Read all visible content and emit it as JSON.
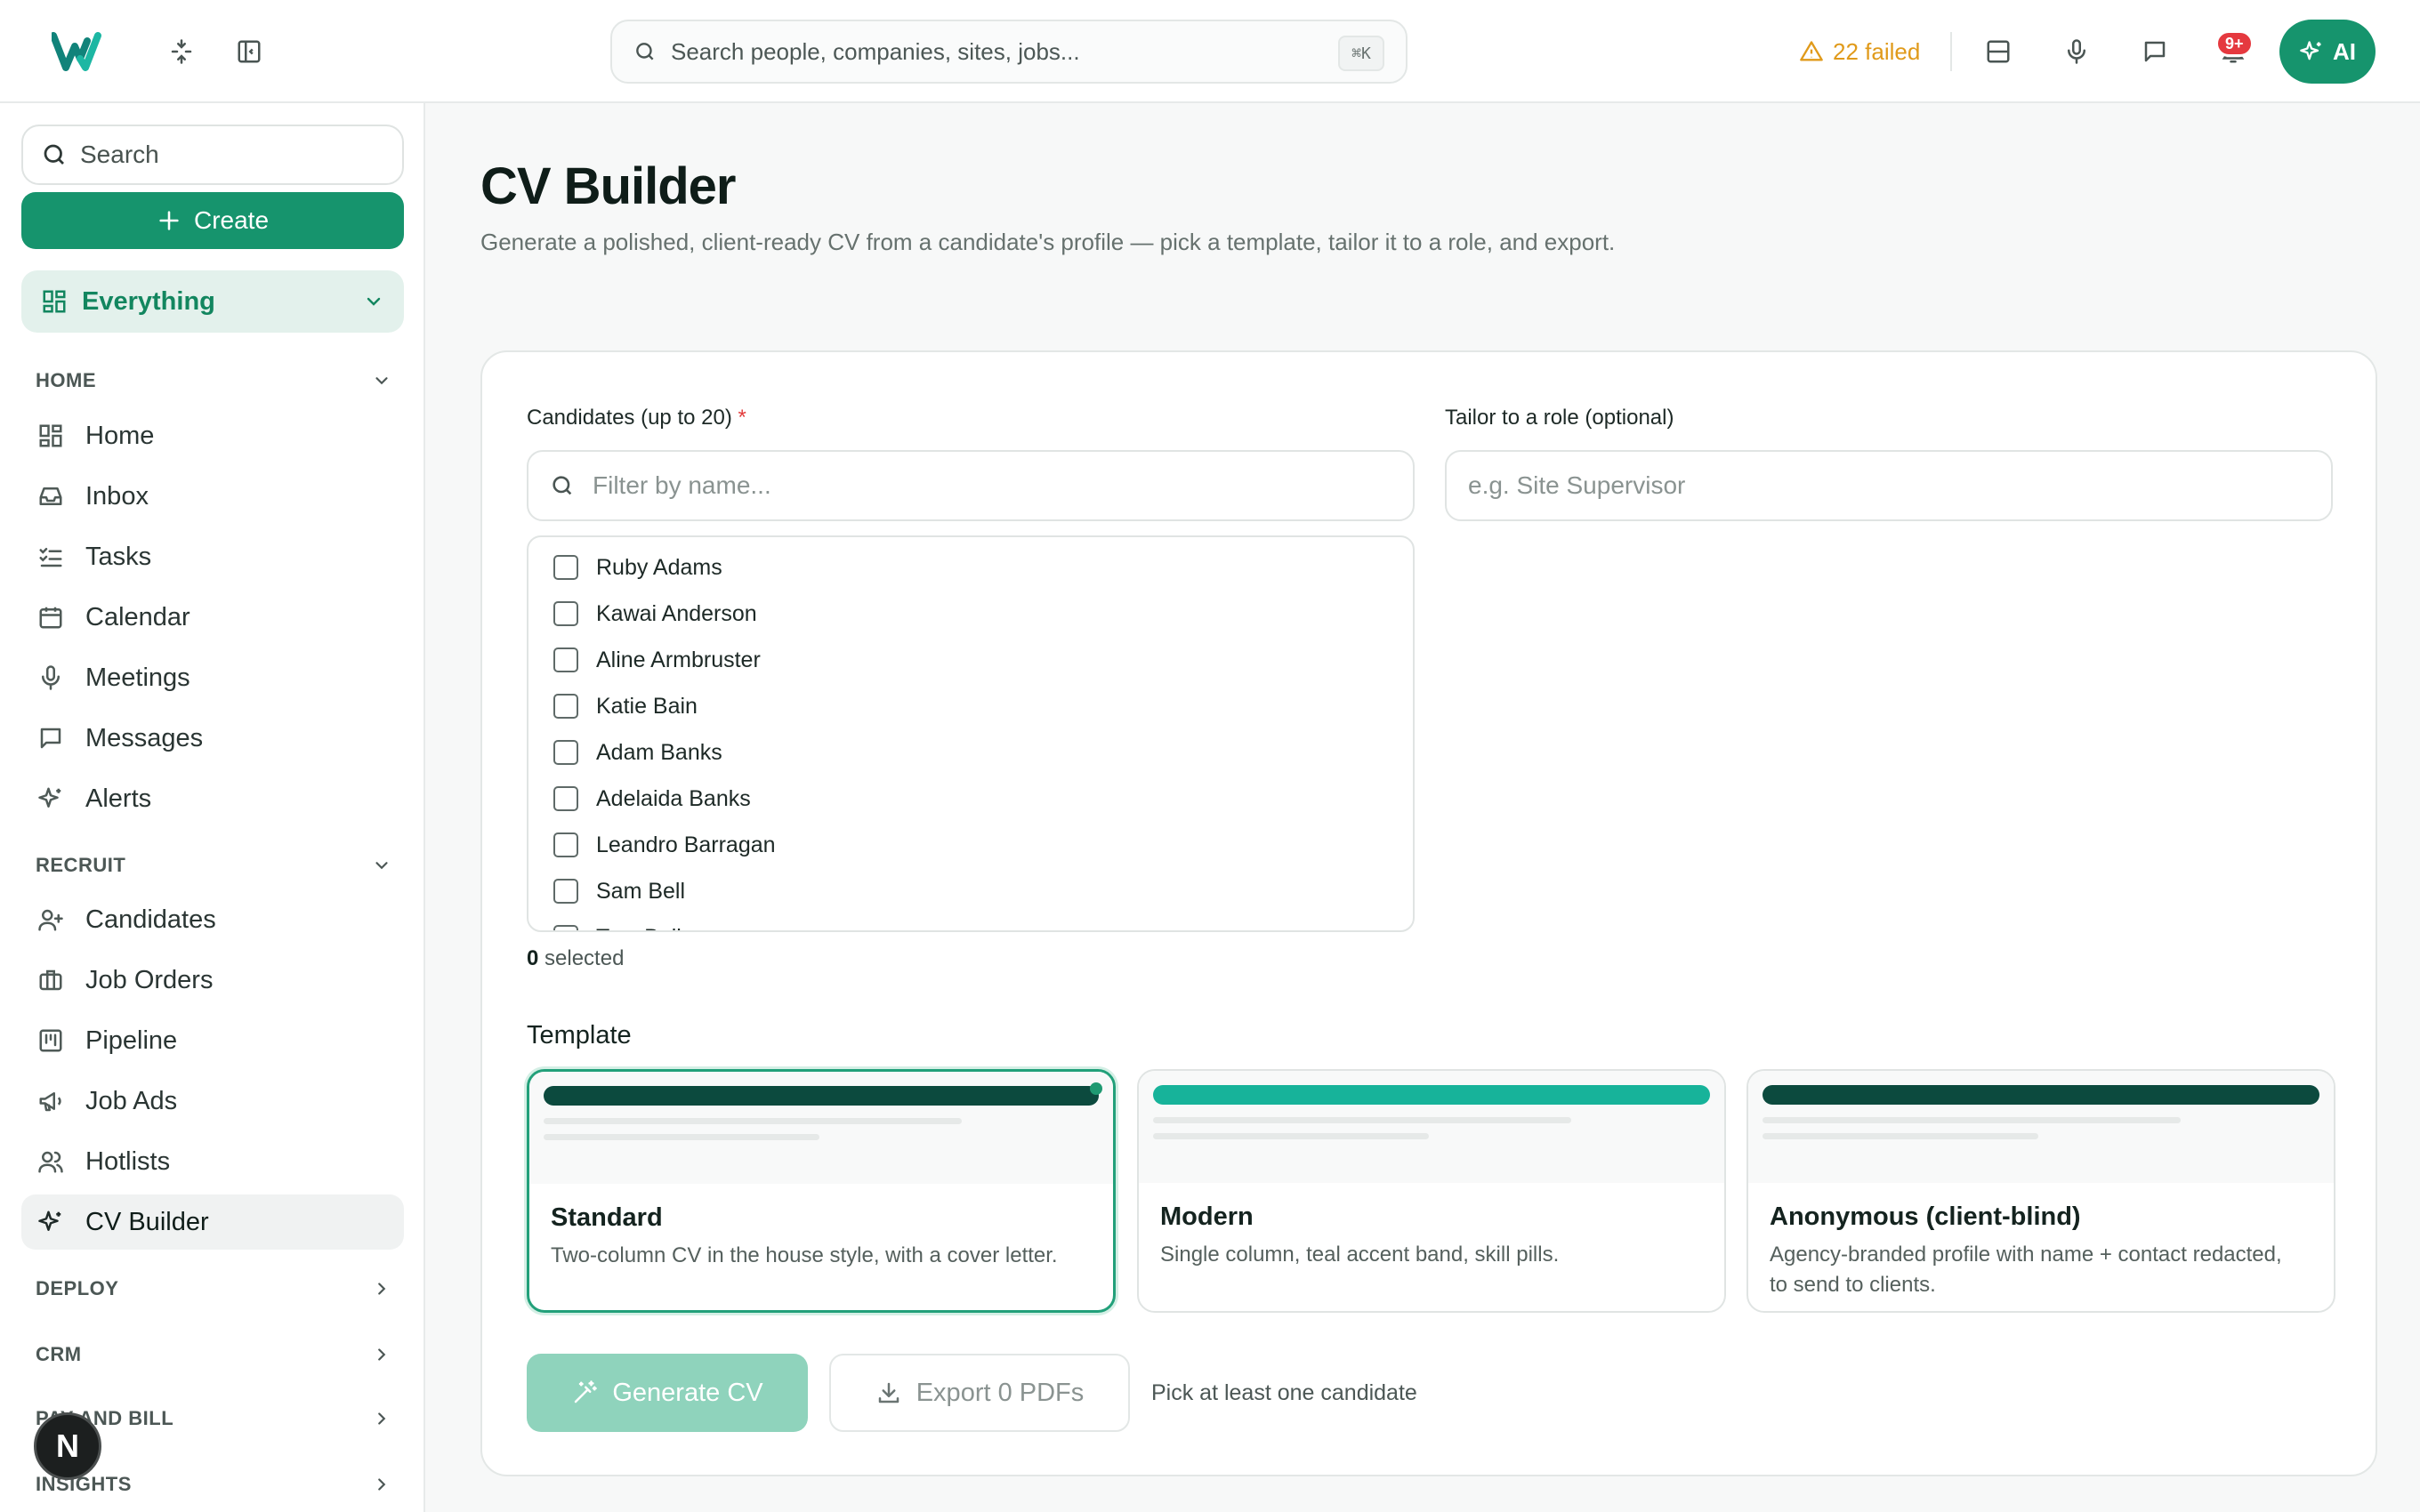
{
  "topbar": {
    "logo": "W",
    "search_placeholder": "Search people, companies, sites, jobs...",
    "shortcut": "⌘K",
    "failed_label": "22 failed",
    "notifications_badge": "9+",
    "ai_label": "AI",
    "icons": [
      "collapse-icon",
      "sidebar-toggle-icon",
      "layout-icon",
      "microphone-icon",
      "chat-icon",
      "bell-icon",
      "sparkle-icon"
    ]
  },
  "sidebar": {
    "search_label": "Search",
    "create_label": "Create",
    "workspace_label": "Everything",
    "sections": {
      "home": "HOME",
      "recruit": "RECRUIT",
      "deploy": "DEPLOY",
      "crm": "CRM",
      "pay": "PAY AND BILL",
      "insights": "INSIGHTS"
    },
    "home_items": [
      "Home",
      "Inbox",
      "Tasks",
      "Calendar",
      "Meetings",
      "Messages",
      "Alerts"
    ],
    "recruit_items": [
      "Candidates",
      "Job Orders",
      "Pipeline",
      "Job Ads",
      "Hotlists",
      "CV Builder"
    ],
    "active_item": "CV Builder",
    "avatar_letter": "N"
  },
  "main": {
    "title": "CV Builder",
    "subtitle": "Generate a polished, client-ready CV from a candidate's profile — pick a template, tailor it to a role, and export.",
    "candidates_label": "Candidates (up to 20)",
    "required_mark": "*",
    "filter_placeholder": "Filter by name...",
    "role_label": "Tailor to a role (optional)",
    "role_placeholder": "e.g. Site Supervisor",
    "candidates": [
      "Ruby Adams",
      "Kawai Anderson",
      "Aline Armbruster",
      "Katie Bain",
      "Adam Banks",
      "Adelaida Banks",
      "Leandro Barragan",
      "Sam Bell",
      "Tom Bell"
    ],
    "selected_count": "0",
    "selected_suffix": "selected",
    "template_heading": "Template",
    "templates": [
      {
        "name": "Standard",
        "desc": "Two-column CV in the house style, with a cover letter.",
        "accent": "#0c4a3e",
        "selected": true
      },
      {
        "name": "Modern",
        "desc": "Single column, teal accent band, skill pills.",
        "accent": "#17b39a",
        "selected": false
      },
      {
        "name": "Anonymous (client-blind)",
        "desc": "Agency-branded profile with name + contact redacted, to send to clients.",
        "accent": "#0c4a3e",
        "selected": false
      }
    ],
    "generate_label": "Generate CV",
    "export_label": "Export 0 PDFs",
    "hint": "Pick at least one candidate"
  },
  "colors": {
    "brand": "#16946d",
    "warning": "#e09a1a",
    "badge": "#e5393f"
  }
}
